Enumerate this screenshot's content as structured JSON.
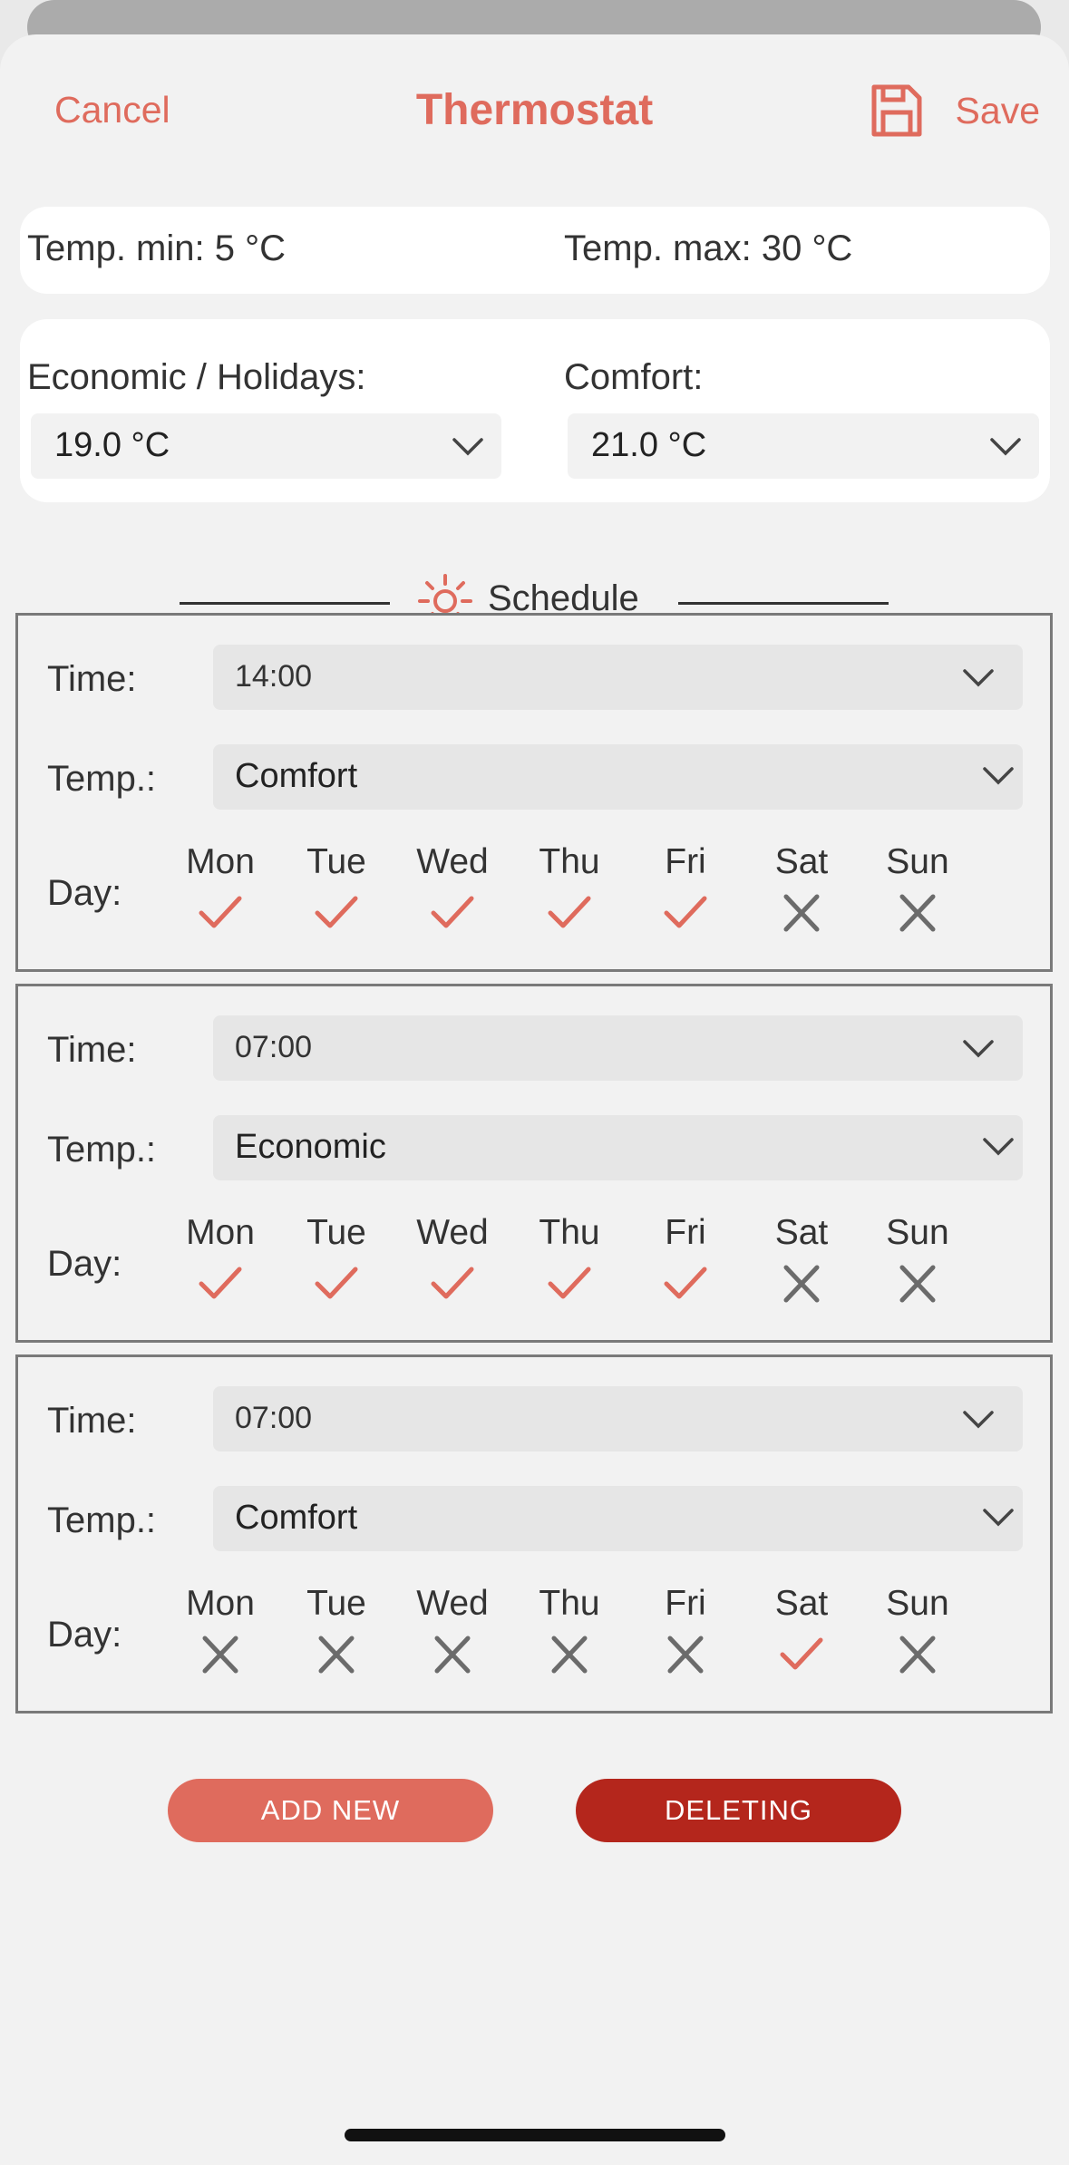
{
  "header": {
    "cancel_label": "Cancel",
    "title": "Thermostat",
    "save_label": "Save",
    "save_icon": "floppy-disk-icon"
  },
  "limits": {
    "min_text": "Temp. min: 5 °C",
    "max_text": "Temp. max: 30 °C"
  },
  "presets": {
    "economic_label": "Economic / Holidays:",
    "economic_value": "19.0 °C",
    "comfort_label": "Comfort:",
    "comfort_value": "21.0 °C"
  },
  "schedule": {
    "title": "Schedule",
    "icon": "sun-icon",
    "time_label": "Time:",
    "temp_label": "Temp.:",
    "day_label": "Day:",
    "days": [
      "Mon",
      "Tue",
      "Wed",
      "Thu",
      "Fri",
      "Sat",
      "Sun"
    ],
    "entries": [
      {
        "time": "14:00",
        "temp": "Comfort",
        "active": [
          true,
          true,
          true,
          true,
          true,
          false,
          false
        ]
      },
      {
        "time": "07:00",
        "temp": "Economic",
        "active": [
          true,
          true,
          true,
          true,
          true,
          false,
          false
        ]
      },
      {
        "time": "07:00",
        "temp": "Comfort",
        "active": [
          false,
          false,
          false,
          false,
          false,
          true,
          false
        ]
      }
    ]
  },
  "actions": {
    "add_label": "ADD NEW",
    "delete_label": "DELETING"
  },
  "colors": {
    "accent": "#df6b5d",
    "delete": "#b4261c",
    "inactive_mark": "#6b6b6b"
  }
}
